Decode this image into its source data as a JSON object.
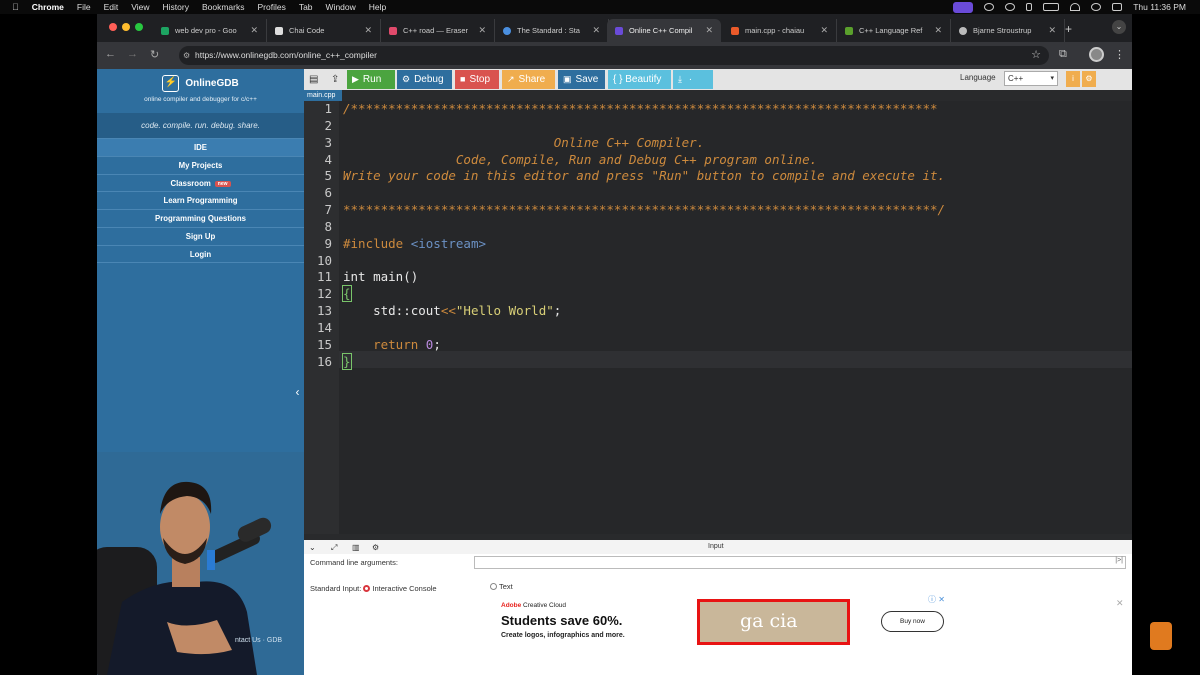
{
  "menubar": {
    "app": "Chrome",
    "items": [
      "File",
      "Edit",
      "View",
      "History",
      "Bookmarks",
      "Profiles",
      "Tab",
      "Window",
      "Help"
    ],
    "clock": "Thu 11:36 PM"
  },
  "tabs": [
    {
      "title": "web dev pro - Goo",
      "color": "#1da462"
    },
    {
      "title": "Chai Code",
      "color": "#ddd"
    },
    {
      "title": "C++ road — Eraser",
      "color": "#e04a6b"
    },
    {
      "title": "The Standard : Sta",
      "color": "#4a8fe0"
    },
    {
      "title": "Online C++ Compil",
      "color": "#6a4bd8"
    },
    {
      "title": "main.cpp - chaiau",
      "color": "#ea5a2a"
    },
    {
      "title": "C++ Language Ref",
      "color": "#5aa02c"
    },
    {
      "title": "Bjarne Stroustrup",
      "color": "#bbb"
    }
  ],
  "url": "https://www.onlinegdb.com/online_c++_compiler",
  "sidebar": {
    "brand": "OnlineGDB",
    "tagline": "online compiler and debugger for c/c++",
    "motto": "code. compile. run. debug. share.",
    "items": [
      "IDE",
      "My Projects",
      "Classroom",
      "Learn Programming",
      "Programming Questions",
      "Sign Up",
      "Login"
    ],
    "new_badge": "new",
    "footer": "ntact Us · GDB"
  },
  "toolbar": {
    "run": "Run",
    "debug": "Debug",
    "stop": "Stop",
    "share": "Share",
    "save": "Save",
    "beautify": "{ } Beautify",
    "language_label": "Language",
    "language_value": "C++"
  },
  "editor": {
    "filename": "main.cpp",
    "line_numbers": [
      "1",
      "2",
      "3",
      "4",
      "5",
      "6",
      "7",
      "8",
      "9",
      "10",
      "11",
      "12",
      "13",
      "14",
      "15",
      "16"
    ],
    "lines": {
      "l1": "/******************************************************************************",
      "l3": "                            Online C++ Compiler.",
      "l4": "               Code, Compile, Run and Debug C++ program online.",
      "l5": "Write your code in this editor and press \"Run\" button to compile and execute it.",
      "l7": "*******************************************************************************/",
      "l9a": "#include ",
      "l9b": "<iostream>",
      "l11": "int main()",
      "l12": "{",
      "l13a": "    std::cout",
      "l13b": "<<",
      "l13c": "\"Hello World\"",
      "l13d": ";",
      "l15a": "    return ",
      "l15b": "0",
      "l15c": ";",
      "l16": "}"
    }
  },
  "io": {
    "title": "Input",
    "cmd_label": "Command line arguments:",
    "stdin_label": "Standard Input:",
    "interactive": "Interactive Console",
    "text": "Text",
    "cmd_end": "|>|"
  },
  "ad": {
    "brand_a": "Adobe",
    "brand_b": "Creative Cloud",
    "headline": "Students save 60%.",
    "sub": "Create logos, infographics and more.",
    "image_text": "ga cia",
    "cta": "Buy now"
  }
}
